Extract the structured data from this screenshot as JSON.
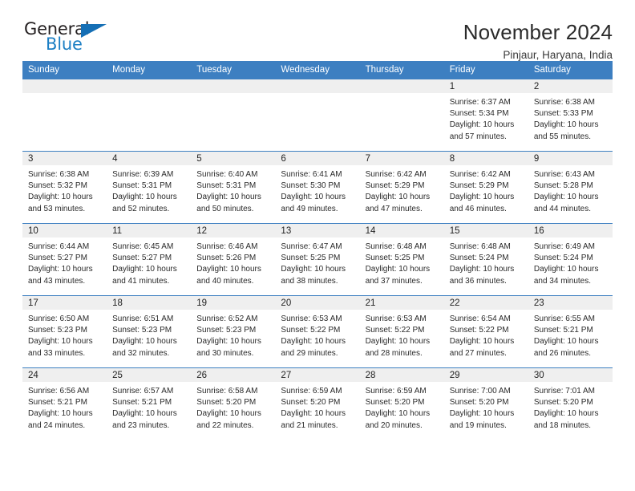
{
  "brand": {
    "name_part1": "General",
    "name_part2": "Blue",
    "triangle_color": "#156fb5",
    "blue_color": "#1c7fc4"
  },
  "header": {
    "title": "November 2024",
    "subtitle": "Pinjaur, Haryana, India"
  },
  "theme": {
    "header_bg": "#3d7fc1",
    "daynum_bg": "#efefef",
    "grid_line": "#3d7fc1"
  },
  "weekday_headers": [
    "Sunday",
    "Monday",
    "Tuesday",
    "Wednesday",
    "Thursday",
    "Friday",
    "Saturday"
  ],
  "labels": {
    "sunrise_prefix": "Sunrise:",
    "sunset_prefix": "Sunset:",
    "daylight_prefix": "Daylight:"
  },
  "weeks": [
    [
      {
        "day": "",
        "empty": true
      },
      {
        "day": "",
        "empty": true
      },
      {
        "day": "",
        "empty": true
      },
      {
        "day": "",
        "empty": true
      },
      {
        "day": "",
        "empty": true
      },
      {
        "day": "1",
        "sunrise": "Sunrise: 6:37 AM",
        "sunset": "Sunset: 5:34 PM",
        "daylight_line1": "Daylight: 10 hours",
        "daylight_line2": "and 57 minutes."
      },
      {
        "day": "2",
        "sunrise": "Sunrise: 6:38 AM",
        "sunset": "Sunset: 5:33 PM",
        "daylight_line1": "Daylight: 10 hours",
        "daylight_line2": "and 55 minutes."
      }
    ],
    [
      {
        "day": "3",
        "sunrise": "Sunrise: 6:38 AM",
        "sunset": "Sunset: 5:32 PM",
        "daylight_line1": "Daylight: 10 hours",
        "daylight_line2": "and 53 minutes."
      },
      {
        "day": "4",
        "sunrise": "Sunrise: 6:39 AM",
        "sunset": "Sunset: 5:31 PM",
        "daylight_line1": "Daylight: 10 hours",
        "daylight_line2": "and 52 minutes."
      },
      {
        "day": "5",
        "sunrise": "Sunrise: 6:40 AM",
        "sunset": "Sunset: 5:31 PM",
        "daylight_line1": "Daylight: 10 hours",
        "daylight_line2": "and 50 minutes."
      },
      {
        "day": "6",
        "sunrise": "Sunrise: 6:41 AM",
        "sunset": "Sunset: 5:30 PM",
        "daylight_line1": "Daylight: 10 hours",
        "daylight_line2": "and 49 minutes."
      },
      {
        "day": "7",
        "sunrise": "Sunrise: 6:42 AM",
        "sunset": "Sunset: 5:29 PM",
        "daylight_line1": "Daylight: 10 hours",
        "daylight_line2": "and 47 minutes."
      },
      {
        "day": "8",
        "sunrise": "Sunrise: 6:42 AM",
        "sunset": "Sunset: 5:29 PM",
        "daylight_line1": "Daylight: 10 hours",
        "daylight_line2": "and 46 minutes."
      },
      {
        "day": "9",
        "sunrise": "Sunrise: 6:43 AM",
        "sunset": "Sunset: 5:28 PM",
        "daylight_line1": "Daylight: 10 hours",
        "daylight_line2": "and 44 minutes."
      }
    ],
    [
      {
        "day": "10",
        "sunrise": "Sunrise: 6:44 AM",
        "sunset": "Sunset: 5:27 PM",
        "daylight_line1": "Daylight: 10 hours",
        "daylight_line2": "and 43 minutes."
      },
      {
        "day": "11",
        "sunrise": "Sunrise: 6:45 AM",
        "sunset": "Sunset: 5:27 PM",
        "daylight_line1": "Daylight: 10 hours",
        "daylight_line2": "and 41 minutes."
      },
      {
        "day": "12",
        "sunrise": "Sunrise: 6:46 AM",
        "sunset": "Sunset: 5:26 PM",
        "daylight_line1": "Daylight: 10 hours",
        "daylight_line2": "and 40 minutes."
      },
      {
        "day": "13",
        "sunrise": "Sunrise: 6:47 AM",
        "sunset": "Sunset: 5:25 PM",
        "daylight_line1": "Daylight: 10 hours",
        "daylight_line2": "and 38 minutes."
      },
      {
        "day": "14",
        "sunrise": "Sunrise: 6:48 AM",
        "sunset": "Sunset: 5:25 PM",
        "daylight_line1": "Daylight: 10 hours",
        "daylight_line2": "and 37 minutes."
      },
      {
        "day": "15",
        "sunrise": "Sunrise: 6:48 AM",
        "sunset": "Sunset: 5:24 PM",
        "daylight_line1": "Daylight: 10 hours",
        "daylight_line2": "and 36 minutes."
      },
      {
        "day": "16",
        "sunrise": "Sunrise: 6:49 AM",
        "sunset": "Sunset: 5:24 PM",
        "daylight_line1": "Daylight: 10 hours",
        "daylight_line2": "and 34 minutes."
      }
    ],
    [
      {
        "day": "17",
        "sunrise": "Sunrise: 6:50 AM",
        "sunset": "Sunset: 5:23 PM",
        "daylight_line1": "Daylight: 10 hours",
        "daylight_line2": "and 33 minutes."
      },
      {
        "day": "18",
        "sunrise": "Sunrise: 6:51 AM",
        "sunset": "Sunset: 5:23 PM",
        "daylight_line1": "Daylight: 10 hours",
        "daylight_line2": "and 32 minutes."
      },
      {
        "day": "19",
        "sunrise": "Sunrise: 6:52 AM",
        "sunset": "Sunset: 5:23 PM",
        "daylight_line1": "Daylight: 10 hours",
        "daylight_line2": "and 30 minutes."
      },
      {
        "day": "20",
        "sunrise": "Sunrise: 6:53 AM",
        "sunset": "Sunset: 5:22 PM",
        "daylight_line1": "Daylight: 10 hours",
        "daylight_line2": "and 29 minutes."
      },
      {
        "day": "21",
        "sunrise": "Sunrise: 6:53 AM",
        "sunset": "Sunset: 5:22 PM",
        "daylight_line1": "Daylight: 10 hours",
        "daylight_line2": "and 28 minutes."
      },
      {
        "day": "22",
        "sunrise": "Sunrise: 6:54 AM",
        "sunset": "Sunset: 5:22 PM",
        "daylight_line1": "Daylight: 10 hours",
        "daylight_line2": "and 27 minutes."
      },
      {
        "day": "23",
        "sunrise": "Sunrise: 6:55 AM",
        "sunset": "Sunset: 5:21 PM",
        "daylight_line1": "Daylight: 10 hours",
        "daylight_line2": "and 26 minutes."
      }
    ],
    [
      {
        "day": "24",
        "sunrise": "Sunrise: 6:56 AM",
        "sunset": "Sunset: 5:21 PM",
        "daylight_line1": "Daylight: 10 hours",
        "daylight_line2": "and 24 minutes."
      },
      {
        "day": "25",
        "sunrise": "Sunrise: 6:57 AM",
        "sunset": "Sunset: 5:21 PM",
        "daylight_line1": "Daylight: 10 hours",
        "daylight_line2": "and 23 minutes."
      },
      {
        "day": "26",
        "sunrise": "Sunrise: 6:58 AM",
        "sunset": "Sunset: 5:20 PM",
        "daylight_line1": "Daylight: 10 hours",
        "daylight_line2": "and 22 minutes."
      },
      {
        "day": "27",
        "sunrise": "Sunrise: 6:59 AM",
        "sunset": "Sunset: 5:20 PM",
        "daylight_line1": "Daylight: 10 hours",
        "daylight_line2": "and 21 minutes."
      },
      {
        "day": "28",
        "sunrise": "Sunrise: 6:59 AM",
        "sunset": "Sunset: 5:20 PM",
        "daylight_line1": "Daylight: 10 hours",
        "daylight_line2": "and 20 minutes."
      },
      {
        "day": "29",
        "sunrise": "Sunrise: 7:00 AM",
        "sunset": "Sunset: 5:20 PM",
        "daylight_line1": "Daylight: 10 hours",
        "daylight_line2": "and 19 minutes."
      },
      {
        "day": "30",
        "sunrise": "Sunrise: 7:01 AM",
        "sunset": "Sunset: 5:20 PM",
        "daylight_line1": "Daylight: 10 hours",
        "daylight_line2": "and 18 minutes."
      }
    ]
  ]
}
